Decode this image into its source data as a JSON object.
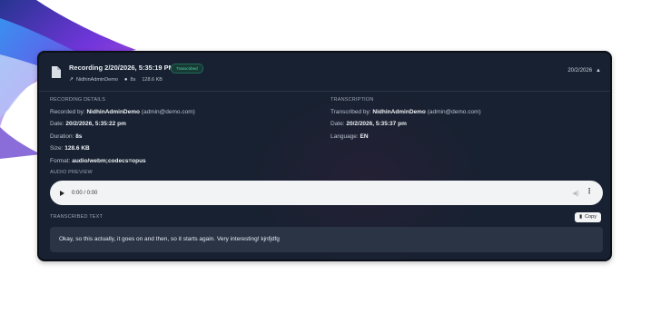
{
  "recording": {
    "title": "Recording 2/20/2026, 5:35:19 PM",
    "status_badge": "Transcribed",
    "user": "NidhinAdminDemo",
    "duration_short": "8s",
    "size_short": "128.6 KB",
    "date_short": "20/2/2026"
  },
  "details": {
    "heading": "RECORDING DETAILS",
    "recorded_by_label": "Recorded by:",
    "recorded_by_name": "NidhinAdminDemo",
    "recorded_by_email": "(admin@demo.com)",
    "date_label": "Date:",
    "date_value": "20/2/2026, 5:35:22 pm",
    "duration_label": "Duration:",
    "duration_value": "8s",
    "size_label": "Size:",
    "size_value": "128.6 KB",
    "format_label": "Format:",
    "format_value": "audio/webm;codecs=opus"
  },
  "transcription": {
    "heading": "TRANSCRIPTION",
    "by_label": "Transcribed by:",
    "by_name": "NidhinAdminDemo",
    "by_email": "(admin@demo.com)",
    "date_label": "Date:",
    "date_value": "20/2/2026, 5:35:37 pm",
    "language_label": "Language:",
    "language_value": "EN"
  },
  "audio": {
    "heading": "AUDIO PREVIEW",
    "time": "0:00 / 0:00"
  },
  "transcribed_text": {
    "heading": "TRANSCRIBED TEXT",
    "copy_label": "Copy",
    "text": "Okay, so this actually, it goes on and then, so it starts again. Very interesting! kjnfjdfg"
  },
  "icons": [
    "file-icon",
    "user-link-icon",
    "duration-icon",
    "chevron-up-icon",
    "play-icon",
    "volume-icon",
    "more-vertical-icon",
    "copy-icon"
  ],
  "colors": {
    "card_bg": "#182131",
    "badge_text": "#4fd1a7",
    "badge_bg": "#173b34",
    "transcript_bg": "#2a3445"
  }
}
